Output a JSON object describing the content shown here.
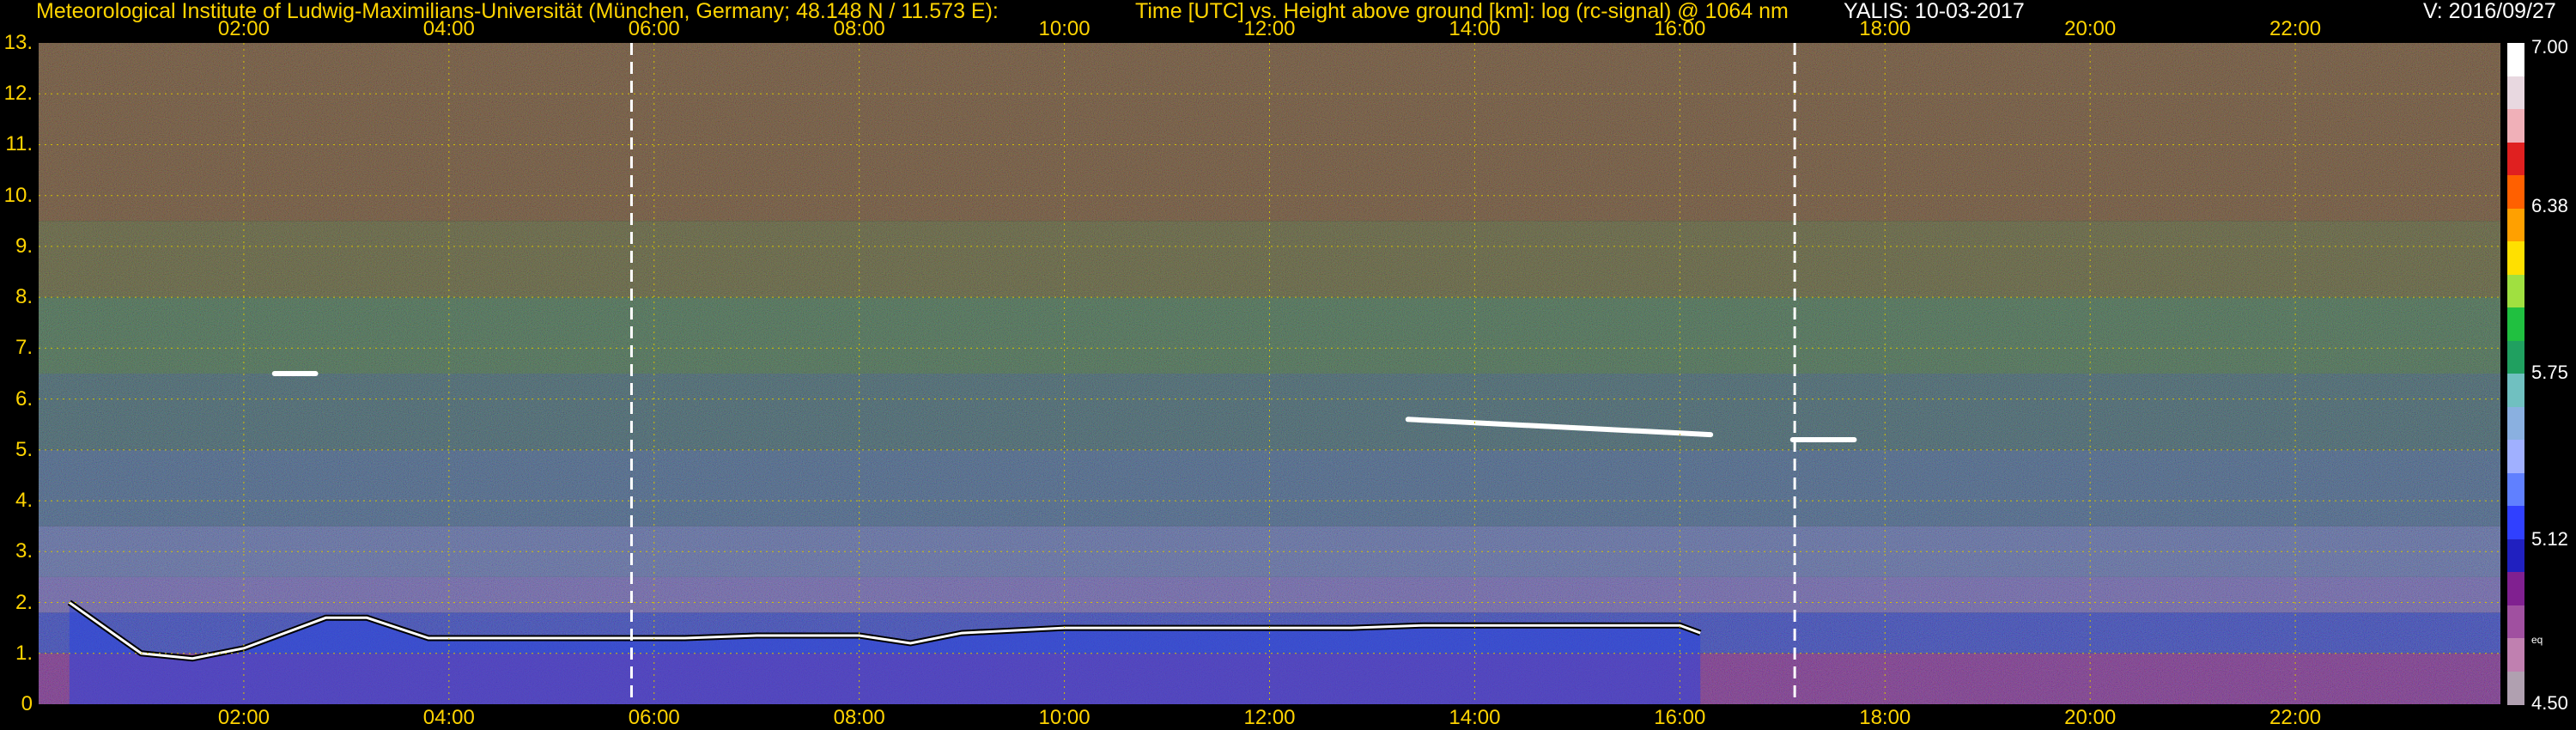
{
  "header": {
    "institute": "Meteorological Institute of Ludwig-Maximilians-Universität (München, Germany; 48.148 N / 11.573 E):",
    "description": "Time [UTC] vs. Height above ground [km]: log (rc-signal) @ 1064 nm",
    "instrument_date": "YALIS: 10-03-2017",
    "version": "V: 2016/09/27"
  },
  "colors": {
    "background": "#000000",
    "header_text": "#ffd400",
    "grid": "#d4c200",
    "dashed_marker": "#ffffff"
  },
  "colorbar": {
    "labels": [
      "7.00",
      "6.38",
      "5.75",
      "5.12",
      "4.50"
    ],
    "values": [
      7.0,
      6.38,
      5.75,
      5.12,
      4.5
    ],
    "small_label": "eq",
    "colors": [
      "#ffffff",
      "#e8d8e0",
      "#f0b0b8",
      "#e02020",
      "#ff6000",
      "#ffa000",
      "#ffe000",
      "#a0e040",
      "#20c040",
      "#20a060",
      "#70c0c0",
      "#8ab0e0",
      "#a0b0ff",
      "#6080ff",
      "#3040ff",
      "#2020c0",
      "#802090",
      "#a050a0",
      "#c080b0",
      "#b0a0b0"
    ]
  },
  "chart_data": {
    "type": "heatmap",
    "title": "Time [UTC] vs. Height above ground [km]: log (rc-signal) @ 1064 nm",
    "x_unit": "hours UTC",
    "xlim": [
      0,
      24
    ],
    "x_ticks": [
      "02:00",
      "04:00",
      "06:00",
      "08:00",
      "10:00",
      "12:00",
      "14:00",
      "16:00",
      "18:00",
      "20:00",
      "22:00"
    ],
    "x_tick_values": [
      2,
      4,
      6,
      8,
      10,
      12,
      14,
      16,
      18,
      20,
      22
    ],
    "ylim": [
      0,
      13
    ],
    "y_ticks": [
      "0",
      "1.",
      "2.",
      "3.",
      "4.",
      "5.",
      "6.",
      "7.",
      "8.",
      "9.",
      "10.",
      "11.",
      "12.",
      "13."
    ],
    "y_tick_values": [
      0,
      1,
      2,
      3,
      4,
      5,
      6,
      7,
      8,
      9,
      10,
      11,
      12,
      13
    ],
    "color_scale": [
      4.5,
      7.0
    ],
    "grid": true,
    "dashed_markers_hours": [
      5.78,
      17.12
    ],
    "boundary_layer_top_km": [
      [
        0.3,
        2.0
      ],
      [
        1.0,
        1.0
      ],
      [
        1.5,
        0.9
      ],
      [
        2.0,
        1.1
      ],
      [
        2.8,
        1.7
      ],
      [
        3.2,
        1.7
      ],
      [
        3.8,
        1.3
      ],
      [
        4.3,
        1.3
      ],
      [
        5.0,
        1.3
      ],
      [
        5.5,
        1.3
      ],
      [
        6.3,
        1.3
      ],
      [
        7.0,
        1.35
      ],
      [
        8.0,
        1.35
      ],
      [
        8.5,
        1.2
      ],
      [
        9.0,
        1.4
      ],
      [
        10.0,
        1.5
      ],
      [
        11.0,
        1.5
      ],
      [
        12.0,
        1.5
      ],
      [
        12.8,
        1.5
      ],
      [
        13.5,
        1.55
      ],
      [
        14.2,
        1.55
      ],
      [
        15.0,
        1.55
      ],
      [
        16.0,
        1.55
      ],
      [
        16.2,
        1.4
      ]
    ],
    "cloud_layers": [
      {
        "t_start": 13.35,
        "t_end": 16.3,
        "h_start": 5.6,
        "h_end": 5.3
      },
      {
        "t_start": 17.1,
        "t_end": 17.7,
        "h_start": 5.2,
        "h_end": 5.2
      },
      {
        "t_start": 2.3,
        "t_end": 2.7,
        "h_start": 6.5,
        "h_end": 6.5
      }
    ]
  }
}
